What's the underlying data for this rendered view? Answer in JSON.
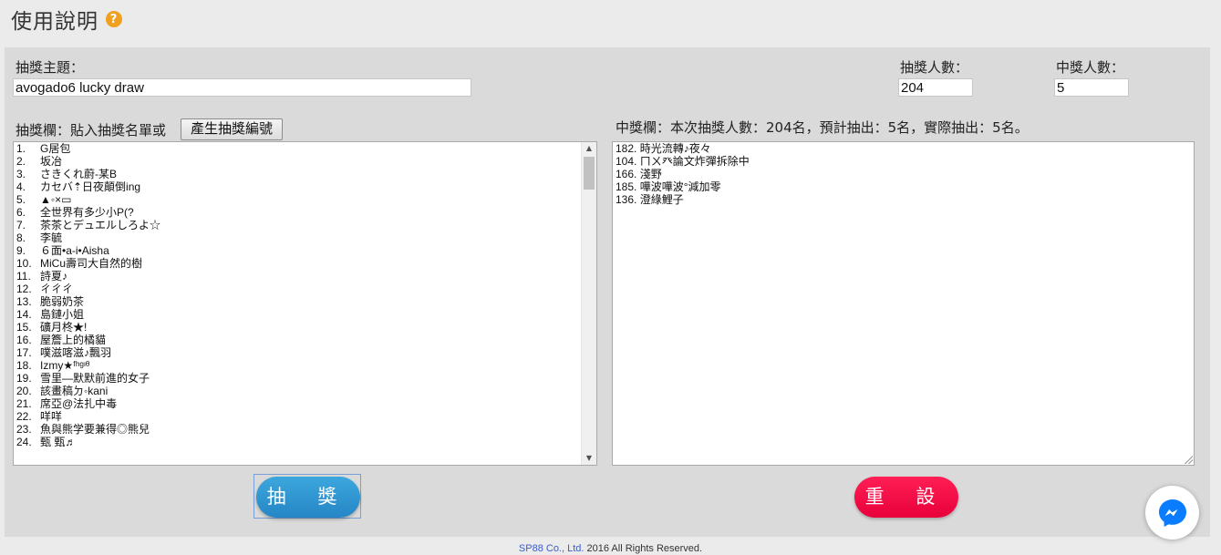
{
  "page_title": "使用說明",
  "topic": {
    "label": "抽獎主題：",
    "value": "avogado6 lucky draw"
  },
  "participants": {
    "label": "抽獎人數：",
    "value": "204"
  },
  "winners_count": {
    "label": "中獎人數：",
    "value": "5"
  },
  "entry_area": {
    "label": "抽獎欄：貼入抽獎名單或",
    "generate_button": "產生抽獎編號",
    "items": [
      {
        "n": "1.",
        "name": "G居包"
      },
      {
        "n": "2.",
        "name": "坂冶"
      },
      {
        "n": "3.",
        "name": "さきくれ蔚-某B"
      },
      {
        "n": "4.",
        "name": "カセバ⇡日夜顛倒ing"
      },
      {
        "n": "5.",
        "name": "▲◦×▭"
      },
      {
        "n": "6.",
        "name": "全世界有多少小P(?"
      },
      {
        "n": "7.",
        "name": "茶茶とデュエルしろよ☆"
      },
      {
        "n": "8.",
        "name": "李毓"
      },
      {
        "n": "9.",
        "name": "６面•a-i•Aisha"
      },
      {
        "n": "10.",
        "name": "MiCu壽司大自然的樹"
      },
      {
        "n": "11.",
        "name": "詩夏♪"
      },
      {
        "n": "12.",
        "name": "ㄔㄔㄔ"
      },
      {
        "n": "13.",
        "name": "脆弱奶茶"
      },
      {
        "n": "14.",
        "name": "島鏈小姐"
      },
      {
        "n": "15.",
        "name": "礦月柊★!"
      },
      {
        "n": "16.",
        "name": "屋簷上的橘貓"
      },
      {
        "n": "17.",
        "name": "噗滋喀滋♪飄羽"
      },
      {
        "n": "18.",
        "name": "Izmy★ᶠʰᵍᶦᶿ"
      },
      {
        "n": "19.",
        "name": "雪里—默默前進的女子"
      },
      {
        "n": "20.",
        "name": "該畫稿ㄉ◦kani"
      },
      {
        "n": "21.",
        "name": "席亞@法扎中毒"
      },
      {
        "n": "22.",
        "name": "咩咩"
      },
      {
        "n": "23.",
        "name": "魚與熊学要兼得◎熊兒"
      },
      {
        "n": "24.",
        "name": "甄 甄♬"
      }
    ]
  },
  "result_area": {
    "label": "中獎欄：本次抽獎人數：204名，預計抽出：5名，實際抽出：5名。",
    "winners": [
      "182. 時光流轉♪夜々",
      "104. ㄇㄨ癶論文炸彈拆除中",
      "166. 淺野",
      "185. 嘩波嘩波°減加零",
      "136. 澄綠鯉子"
    ]
  },
  "draw_button": "抽 獎",
  "reset_button": "重 設",
  "footer": {
    "company": "SP88 Co., Ltd.",
    "rights": " 2016 All Rights Reserved."
  },
  "colors": {
    "draw": "#2a8fcf",
    "reset": "#f5124a",
    "messenger": "#0a7cff",
    "help": "#f0a020"
  },
  "icons": {
    "help": "question-circle-icon",
    "messenger": "messenger-icon"
  }
}
